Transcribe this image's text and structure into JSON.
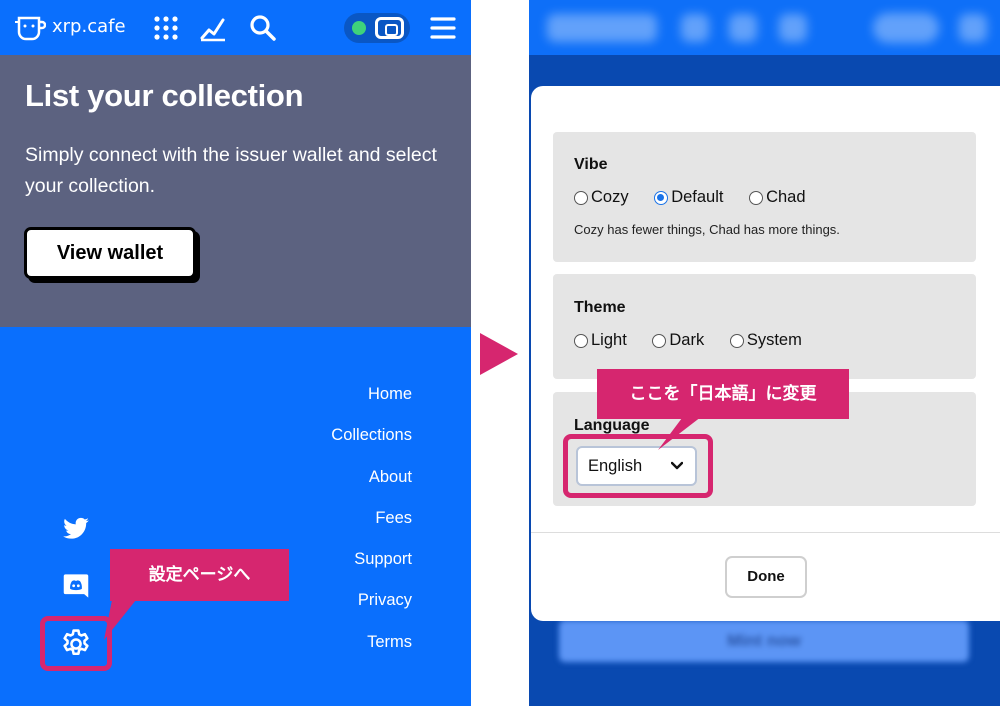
{
  "header": {
    "logo_text": "xrp.cafe",
    "icons": [
      "mug-logo-icon",
      "grid-icon",
      "chart-icon",
      "search-icon",
      "wallet-icon",
      "menu-icon"
    ],
    "wallet_status_color": "#3fd27b"
  },
  "hero": {
    "title": "List your collection",
    "text": "Simply connect with the issuer wallet and select your collection.",
    "button_label": "View wallet"
  },
  "footer": {
    "links": [
      "Home",
      "Collections",
      "About",
      "Fees",
      "Support",
      "Privacy",
      "Terms"
    ],
    "social_icons": [
      "twitter-icon",
      "discord-icon",
      "gear-icon"
    ]
  },
  "annotations": {
    "left_callout": "設定ページへ",
    "right_callout": "ここを「日本語」に変更",
    "accent_color": "#d6266f"
  },
  "settings": {
    "vibe": {
      "title": "Vibe",
      "options": [
        "Cozy",
        "Default",
        "Chad"
      ],
      "selected": "Default",
      "description": "Cozy has fewer things, Chad has more things."
    },
    "theme": {
      "title": "Theme",
      "options": [
        "Light",
        "Dark",
        "System"
      ],
      "selected": null
    },
    "language": {
      "title": "Language",
      "value": "English"
    },
    "done_label": "Done"
  },
  "background": {
    "mint_label": "Mint now"
  }
}
